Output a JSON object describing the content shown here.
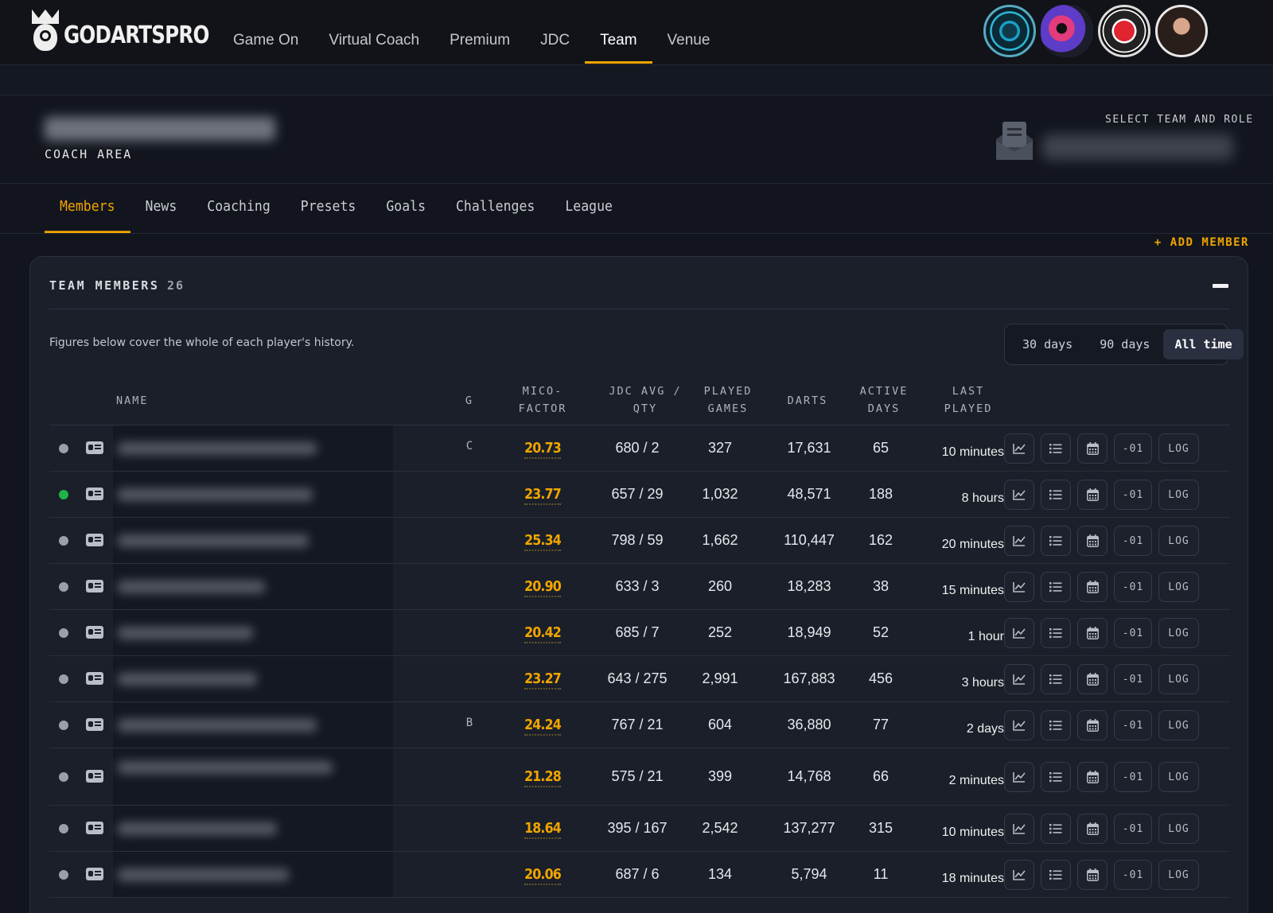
{
  "brand": {
    "name": "GODARTSPRO"
  },
  "nav": {
    "items": [
      {
        "label": "Game On",
        "active": false
      },
      {
        "label": "Virtual Coach",
        "active": false
      },
      {
        "label": "Premium",
        "active": false
      },
      {
        "label": "JDC",
        "active": false
      },
      {
        "label": "Team",
        "active": true
      },
      {
        "label": "Venue",
        "active": false
      }
    ]
  },
  "header": {
    "section_label": "COACH AREA",
    "select_label": "SELECT TEAM AND ROLE"
  },
  "subnav": {
    "tabs": [
      {
        "label": "Members",
        "active": true
      },
      {
        "label": "News",
        "active": false
      },
      {
        "label": "Coaching",
        "active": false
      },
      {
        "label": "Presets",
        "active": false
      },
      {
        "label": "Goals",
        "active": false
      },
      {
        "label": "Challenges",
        "active": false
      },
      {
        "label": "League",
        "active": false
      }
    ],
    "add_member": "+ ADD MEMBER"
  },
  "panel": {
    "title": "TEAM MEMBERS",
    "count": "26",
    "note": "Figures below cover the whole of each player's history.",
    "range_options": [
      {
        "label": "30 days",
        "active": false
      },
      {
        "label": "90 days",
        "active": false
      },
      {
        "label": "All time",
        "active": true
      }
    ]
  },
  "table": {
    "columns": {
      "name": "NAME",
      "g": "G",
      "mico_1": "MICO-",
      "mico_2": "FACTOR",
      "jdc_1": "JDC AVG /",
      "jdc_2": "QTY",
      "played_1": "PLAYED",
      "played_2": "GAMES",
      "darts": "DARTS",
      "active_1": "ACTIVE",
      "active_2": "DAYS",
      "last_1": "LAST",
      "last_2": "PLAYED"
    },
    "action_labels": {
      "minus": "-01",
      "log": "LOG"
    },
    "rows": [
      {
        "online": false,
        "g": "C",
        "mico": "20.73",
        "jdc": "680 / 2",
        "played": "327",
        "darts": "17,631",
        "active": "65",
        "last": "10 minutes"
      },
      {
        "online": true,
        "g": "",
        "mico": "23.77",
        "jdc": "657 / 29",
        "played": "1,032",
        "darts": "48,571",
        "active": "188",
        "last": "8 hours"
      },
      {
        "online": false,
        "g": "",
        "mico": "25.34",
        "jdc": "798 / 59",
        "played": "1,662",
        "darts": "110,447",
        "active": "162",
        "last": "20 minutes"
      },
      {
        "online": false,
        "g": "",
        "mico": "20.90",
        "jdc": "633 / 3",
        "played": "260",
        "darts": "18,283",
        "active": "38",
        "last": "15 minutes"
      },
      {
        "online": false,
        "g": "",
        "mico": "20.42",
        "jdc": "685 / 7",
        "played": "252",
        "darts": "18,949",
        "active": "52",
        "last": "1 hour"
      },
      {
        "online": false,
        "g": "",
        "mico": "23.27",
        "jdc": "643 / 275",
        "played": "2,991",
        "darts": "167,883",
        "active": "456",
        "last": "3 hours"
      },
      {
        "online": false,
        "g": "B",
        "mico": "24.24",
        "jdc": "767 / 21",
        "played": "604",
        "darts": "36,880",
        "active": "77",
        "last": "2 days"
      },
      {
        "online": false,
        "g": "",
        "mico": "21.28",
        "jdc": "575 / 21",
        "played": "399",
        "darts": "14,768",
        "active": "66",
        "last": "2 minutes"
      },
      {
        "online": false,
        "g": "",
        "mico": "18.64",
        "jdc": "395 / 167",
        "played": "2,542",
        "darts": "137,277",
        "active": "315",
        "last": "10 minutes"
      },
      {
        "online": false,
        "g": "",
        "mico": "20.06",
        "jdc": "687 / 6",
        "played": "134",
        "darts": "5,794",
        "active": "11",
        "last": "18 minutes"
      }
    ]
  },
  "colors": {
    "accent": "#f0a500",
    "online": "#1fb34a",
    "background": "#12151d"
  }
}
